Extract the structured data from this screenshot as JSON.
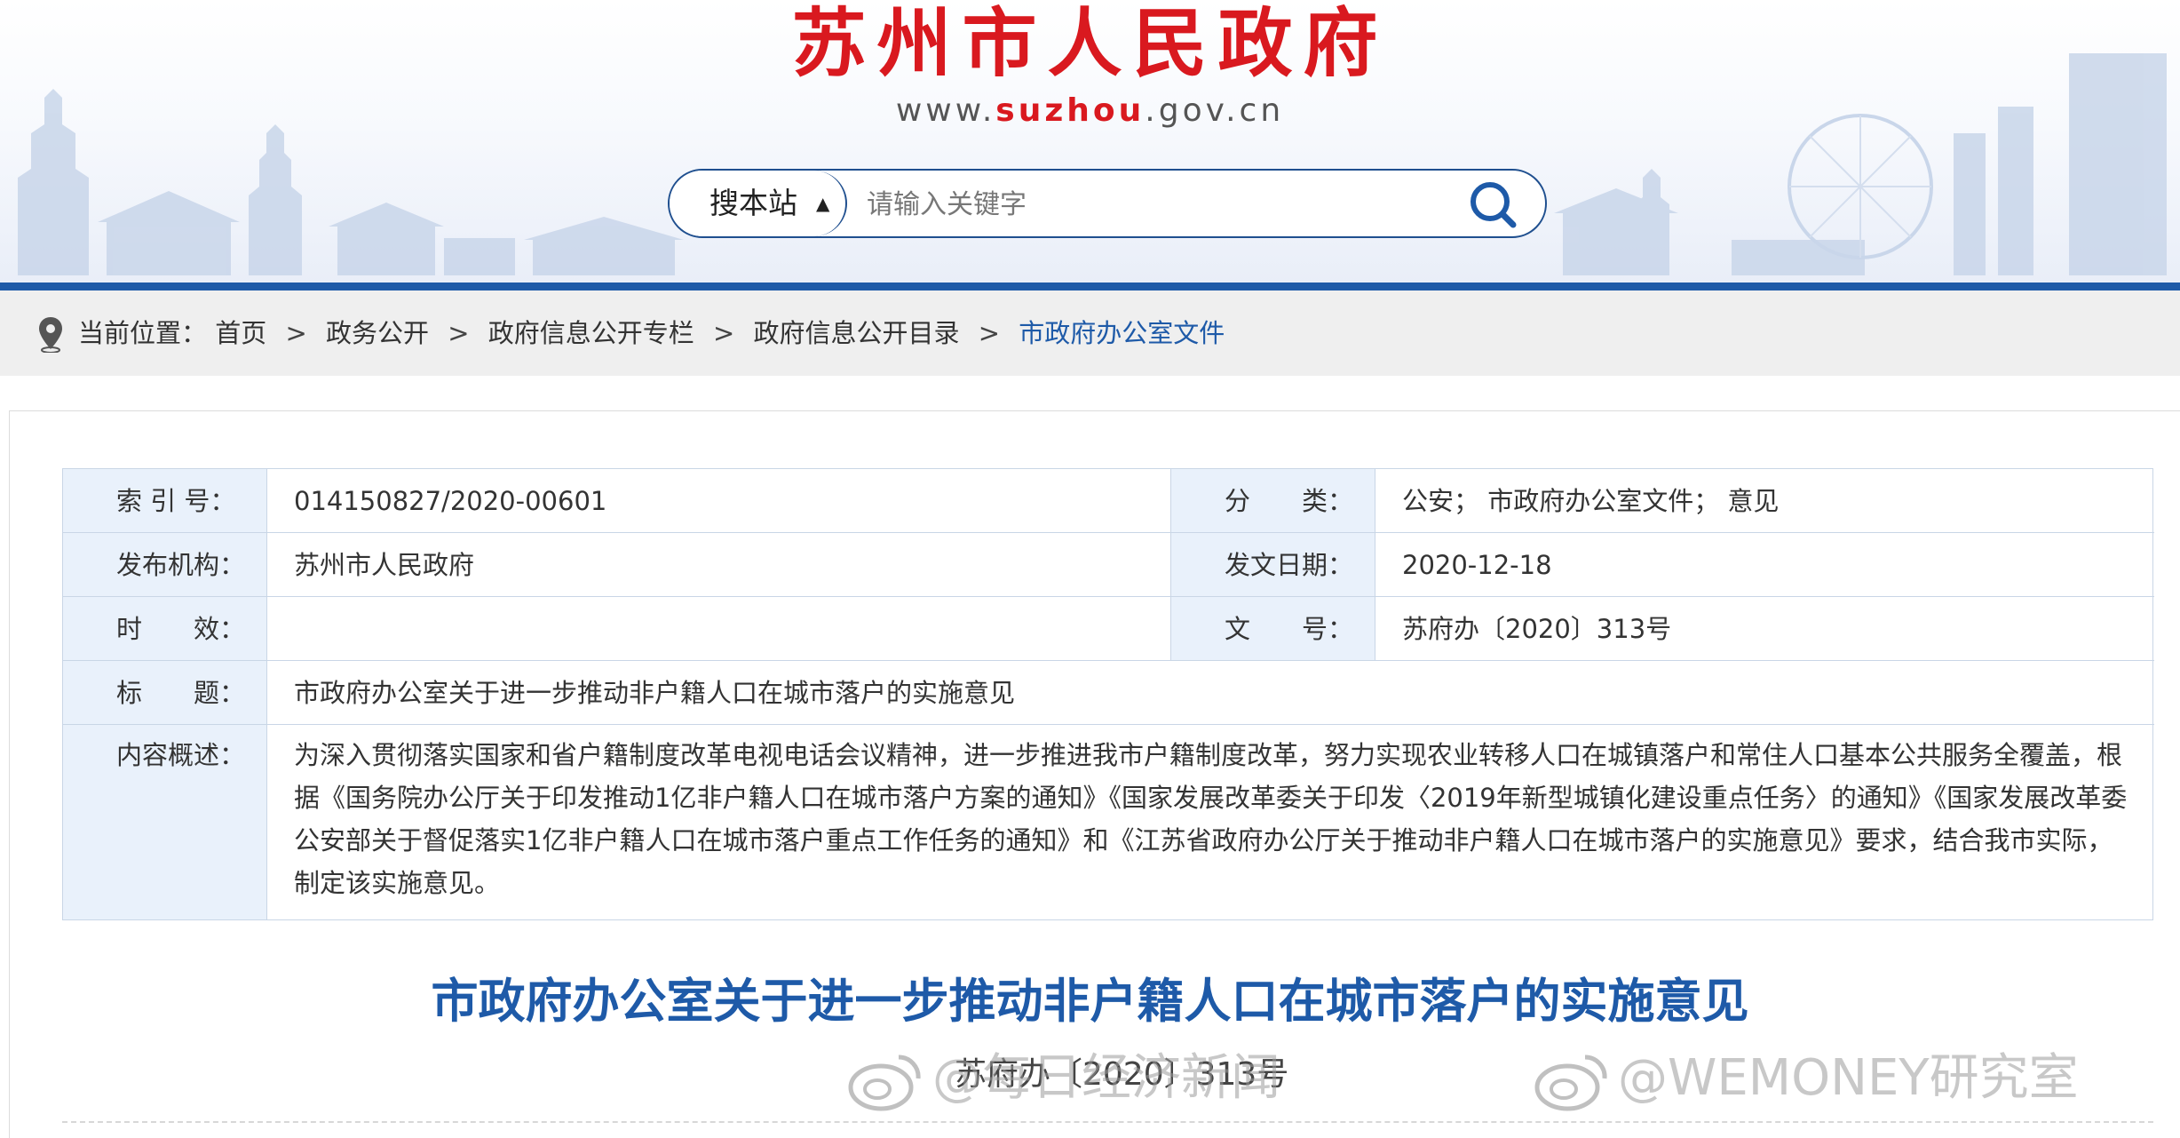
{
  "header": {
    "site_title": "苏州市人民政府",
    "url_prefix": "www.",
    "url_domain": "suzhou",
    "url_suffix": ".gov.cn"
  },
  "search": {
    "scope_label": "搜本站",
    "placeholder": "请输入关键字"
  },
  "breadcrumb": {
    "prefix": "当前位置：",
    "items": [
      "首页",
      "政务公开",
      "政府信息公开专栏",
      "政府信息公开目录",
      "市政府办公室文件"
    ],
    "separator": ">"
  },
  "meta": {
    "index_no_label": "索 引 号：",
    "index_no": "014150827/2020-00601",
    "category_label": "分　　类：",
    "category": "公安；  市政府办公室文件；  意见",
    "publisher_label": "发布机构：",
    "publisher": "苏州市人民政府",
    "issue_date_label": "发文日期：",
    "issue_date": "2020-12-18",
    "validity_label": "时　　效：",
    "validity": "",
    "doc_no_label": "文　　号：",
    "doc_no": "苏府办〔2020〕313号",
    "title_label": "标　　题：",
    "title": "市政府办公室关于进一步推动非户籍人口在城市落户的实施意见",
    "summary_label": "内容概述：",
    "summary": "为深入贯彻落实国家和省户籍制度改革电视电话会议精神，进一步推进我市户籍制度改革，努力实现农业转移人口在城镇落户和常住人口基本公共服务全覆盖，根据《国务院办公厅关于印发推动1亿非户籍人口在城市落户方案的通知》《国家发展改革委关于印发〈2019年新型城镇化建设重点任务〉的通知》《国家发展改革委公安部关于督促落实1亿非户籍人口在城市落户重点工作任务的通知》和《江苏省政府办公厅关于推动非户籍人口在城市落户的实施意见》要求，结合我市实际，制定该实施意见。"
  },
  "article": {
    "title": "市政府办公室关于进一步推动非户籍人口在城市落户的实施意见",
    "doc_number": "苏府办〔2020〕313号"
  },
  "watermarks": {
    "left": "@每日经济新闻",
    "right": "@WEMONEY研究室"
  },
  "colors": {
    "brand_red": "#d9191f",
    "brand_blue": "#1e5aa8",
    "label_bg": "#e9f1fb"
  }
}
